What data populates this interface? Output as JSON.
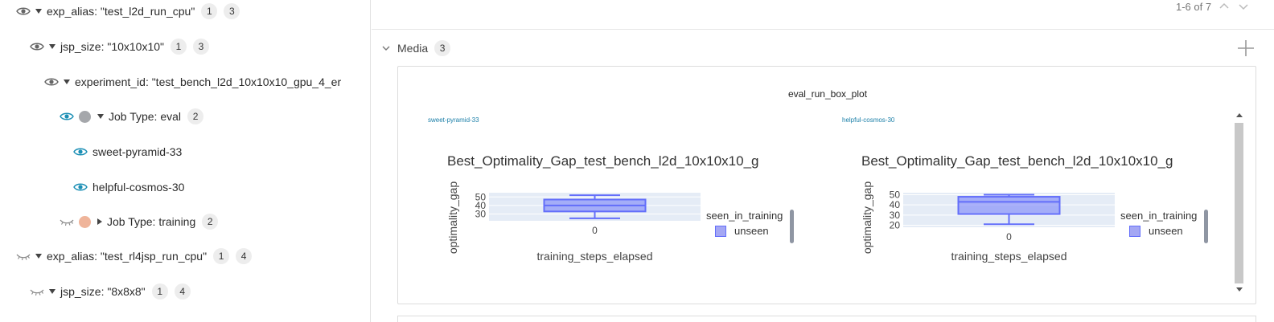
{
  "tree": {
    "rows": [
      {
        "label": "exp_alias: \"test_l2d_run_cpu\"",
        "badge1": "1",
        "badge2": "3"
      },
      {
        "label": "jsp_size: \"10x10x10\"",
        "badge1": "1",
        "badge2": "3"
      },
      {
        "label": "experiment_id: \"test_bench_l2d_10x10x10_gpu_4_er",
        "badge1": "",
        "badge2": ""
      },
      {
        "label": "Job Type: eval",
        "badge1": "2",
        "badge2": ""
      },
      {
        "label": "sweet-pyramid-33",
        "badge1": "",
        "badge2": ""
      },
      {
        "label": "helpful-cosmos-30",
        "badge1": "",
        "badge2": ""
      },
      {
        "label": "Job Type: training",
        "badge1": "2",
        "badge2": ""
      },
      {
        "label": "exp_alias: \"test_rl4jsp_run_cpu\"",
        "badge1": "1",
        "badge2": "4"
      },
      {
        "label": "jsp_size: \"8x8x8\"",
        "badge1": "1",
        "badge2": "4"
      }
    ],
    "group_colors": {
      "eval": "#a5a7ab",
      "training": "#efb49a"
    },
    "eye_visible_color": "#1b8fb5",
    "eye_muted_color": "#777777"
  },
  "pager": {
    "text": "1-6 of 7"
  },
  "section": {
    "title": "Media",
    "count": "3"
  },
  "panel": {
    "title": "eval_run_box_plot",
    "runs": [
      "sweet-pyramid-33",
      "helpful-cosmos-30"
    ],
    "plots": [
      {
        "title": "Best_Optimality_Gap_test_bench_l2d_10x10x10_g",
        "ylabel": "optimality_gap",
        "xlabel": "training_steps_elapsed",
        "xtick": "0",
        "legend_title": "seen_in_training",
        "legend_item": "unseen"
      },
      {
        "title": "Best_Optimality_Gap_test_bench_l2d_10x10x10_g",
        "ylabel": "optimality_gap",
        "xlabel": "training_steps_elapsed",
        "xtick": "0",
        "legend_title": "seen_in_training",
        "legend_item": "unseen"
      }
    ]
  },
  "chart_data": [
    {
      "type": "box",
      "title": "Best_Optimality_Gap_test_bench_l2d_10x10x10_g",
      "xlabel": "training_steps_elapsed",
      "ylabel": "optimality_gap",
      "categories": [
        "0"
      ],
      "yticks": [
        30,
        40,
        50
      ],
      "ylim": [
        22,
        55
      ],
      "series": [
        {
          "name": "unseen",
          "min": 25,
          "q1": 33,
          "median": 40,
          "q3": 47,
          "max": 52
        }
      ],
      "legend_title": "seen_in_training",
      "color": "#636efa"
    },
    {
      "type": "box",
      "title": "Best_Optimality_Gap_test_bench_l2d_10x10x10_g",
      "xlabel": "training_steps_elapsed",
      "ylabel": "optimality_gap",
      "categories": [
        "0"
      ],
      "yticks": [
        20,
        30,
        40,
        50
      ],
      "ylim": [
        18,
        52
      ],
      "series": [
        {
          "name": "unseen",
          "min": 21,
          "q1": 31,
          "median": 43,
          "q3": 48,
          "max": 50
        }
      ],
      "legend_title": "seen_in_training",
      "color": "#636efa"
    }
  ]
}
